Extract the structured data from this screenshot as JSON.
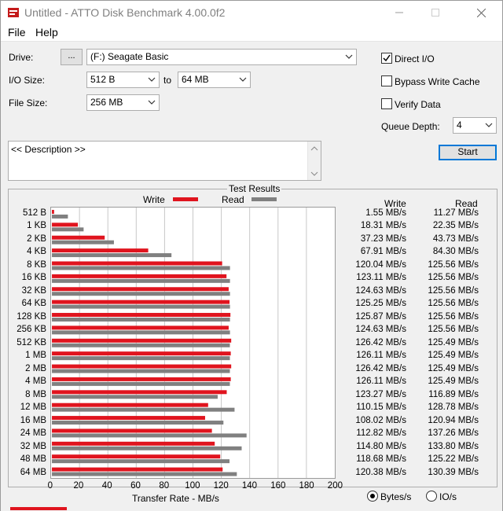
{
  "window": {
    "title": "Untitled - ATTO Disk Benchmark 4.00.0f2"
  },
  "menu": {
    "file": "File",
    "help": "Help"
  },
  "drive": {
    "label": "Drive:",
    "browse": "...",
    "value": "(F:) Seagate Basic"
  },
  "io_size": {
    "label": "I/O Size:",
    "from": "512 B",
    "to_label": "to",
    "to": "64 MB"
  },
  "file_size": {
    "label": "File Size:",
    "value": "256 MB"
  },
  "options": {
    "direct_io": {
      "label": "Direct I/O",
      "checked": true
    },
    "bypass_write_cache": {
      "label": "Bypass Write Cache",
      "checked": false
    },
    "verify_data": {
      "label": "Verify Data",
      "checked": false
    },
    "queue_depth": {
      "label": "Queue Depth:",
      "value": "4"
    }
  },
  "start_label": "Start",
  "description": {
    "text": "<< Description >>"
  },
  "results": {
    "title": "Test Results",
    "legend_write": "Write",
    "legend_read": "Read",
    "col_write": "Write",
    "col_read": "Read",
    "xlabel": "Transfer Rate - MB/s",
    "units_bytes": "Bytes/s",
    "units_io": "IO/s",
    "units_selected": "Bytes/s"
  },
  "colors": {
    "write": "#e0141e",
    "read": "#808080"
  },
  "chart_data": {
    "type": "bar",
    "orientation": "horizontal",
    "title": "Test Results",
    "xlabel": "Transfer Rate - MB/s",
    "xlim": [
      0,
      200
    ],
    "xticks": [
      0,
      20,
      40,
      60,
      80,
      100,
      120,
      140,
      160,
      180,
      200
    ],
    "legend_position": "top",
    "grid": true,
    "categories": [
      "512 B",
      "1 KB",
      "2 KB",
      "4 KB",
      "8 KB",
      "16 KB",
      "32 KB",
      "64 KB",
      "128 KB",
      "256 KB",
      "512 KB",
      "1 MB",
      "2 MB",
      "4 MB",
      "8 MB",
      "12 MB",
      "16 MB",
      "24 MB",
      "32 MB",
      "48 MB",
      "64 MB"
    ],
    "series": [
      {
        "name": "Write",
        "values": [
          1.55,
          18.31,
          37.23,
          67.91,
          120.04,
          123.11,
          124.63,
          125.25,
          125.87,
          124.63,
          126.42,
          126.11,
          126.42,
          126.11,
          123.27,
          110.15,
          108.02,
          112.82,
          114.8,
          118.68,
          120.38
        ],
        "labels": [
          "1.55 MB/s",
          "18.31 MB/s",
          "37.23 MB/s",
          "67.91 MB/s",
          "120.04 MB/s",
          "123.11 MB/s",
          "124.63 MB/s",
          "125.25 MB/s",
          "125.87 MB/s",
          "124.63 MB/s",
          "126.42 MB/s",
          "126.11 MB/s",
          "126.42 MB/s",
          "126.11 MB/s",
          "123.27 MB/s",
          "110.15 MB/s",
          "108.02 MB/s",
          "112.82 MB/s",
          "114.80 MB/s",
          "118.68 MB/s",
          "120.38 MB/s"
        ]
      },
      {
        "name": "Read",
        "values": [
          11.27,
          22.35,
          43.73,
          84.3,
          125.56,
          125.56,
          125.56,
          125.56,
          125.56,
          125.56,
          125.49,
          125.49,
          125.49,
          125.49,
          116.89,
          128.78,
          120.94,
          137.26,
          133.8,
          125.22,
          130.39
        ],
        "labels": [
          "11.27 MB/s",
          "22.35 MB/s",
          "43.73 MB/s",
          "84.30 MB/s",
          "125.56 MB/s",
          "125.56 MB/s",
          "125.56 MB/s",
          "125.56 MB/s",
          "125.56 MB/s",
          "125.56 MB/s",
          "125.49 MB/s",
          "125.49 MB/s",
          "125.49 MB/s",
          "125.49 MB/s",
          "116.89 MB/s",
          "128.78 MB/s",
          "120.94 MB/s",
          "137.26 MB/s",
          "133.80 MB/s",
          "125.22 MB/s",
          "130.39 MB/s"
        ]
      }
    ]
  }
}
